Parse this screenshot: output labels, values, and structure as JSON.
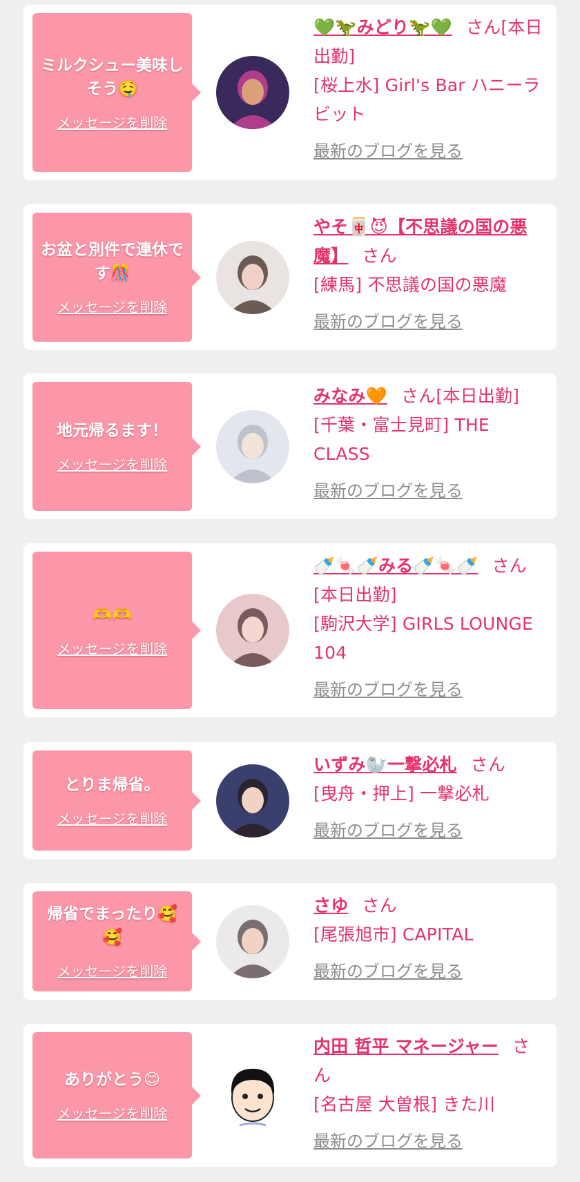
{
  "entries": [
    {
      "message": "ミルクシュー美味しそう🤤",
      "delete_label": "メッセージを削除",
      "name": "💚🦖みどり🦖💚",
      "suffix": "さん",
      "status": "[本日出勤]",
      "shop": "[桜上水] Girl's Bar ハニーラビット",
      "blog_label": "最新のブログを見る",
      "avatar_icon": "girl-photo-avatar"
    },
    {
      "message": "お盆と別件で連休です🎊",
      "delete_label": "メッセージを削除",
      "name": "やそ🀄😈【不思議の国の悪魔】",
      "suffix": "さん",
      "status": "",
      "shop": "[練馬] 不思議の国の悪魔",
      "blog_label": "最新のブログを見る",
      "avatar_icon": "girl-photo-avatar"
    },
    {
      "message": "地元帰るます！",
      "delete_label": "メッセージを削除",
      "name": "みなみ🧡",
      "suffix": "さん",
      "status": "[本日出勤]",
      "shop": "[千葉・富士見町] THE CLASS",
      "blog_label": "最新のブログを見る",
      "avatar_icon": "girl-photo-avatar"
    },
    {
      "message": "🫶🫶",
      "delete_label": "メッセージを削除",
      "name": "🍼🍬🍼みる🍼🍬🍼",
      "suffix": "さん",
      "status": "[本日出勤]",
      "shop": "[駒沢大学] GIRLS LOUNGE 104",
      "blog_label": "最新のブログを見る",
      "avatar_icon": "girl-photo-avatar"
    },
    {
      "message": "とりま帰省。",
      "delete_label": "メッセージを削除",
      "name": "いずみ🦭一撃必札",
      "suffix": "さん",
      "status": "",
      "shop": "[曳舟・押上] 一撃必札",
      "blog_label": "最新のブログを見る",
      "avatar_icon": "girl-photo-avatar"
    },
    {
      "message": "帰省でまったり🥰🥰",
      "delete_label": "メッセージを削除",
      "name": "さゆ",
      "suffix": "さん",
      "status": "",
      "shop": "[尾張旭市] CAPITAL",
      "blog_label": "最新のブログを見る",
      "avatar_icon": "girl-photo-avatar"
    },
    {
      "message": "ありがとう😊",
      "delete_label": "メッセージを削除",
      "name": "内田 哲平 マネージャー",
      "suffix": "さん",
      "status": "",
      "shop": "[名古屋 大曽根] きた川",
      "blog_label": "最新のブログを見る",
      "avatar_icon": "manager-cartoon-avatar"
    }
  ]
}
